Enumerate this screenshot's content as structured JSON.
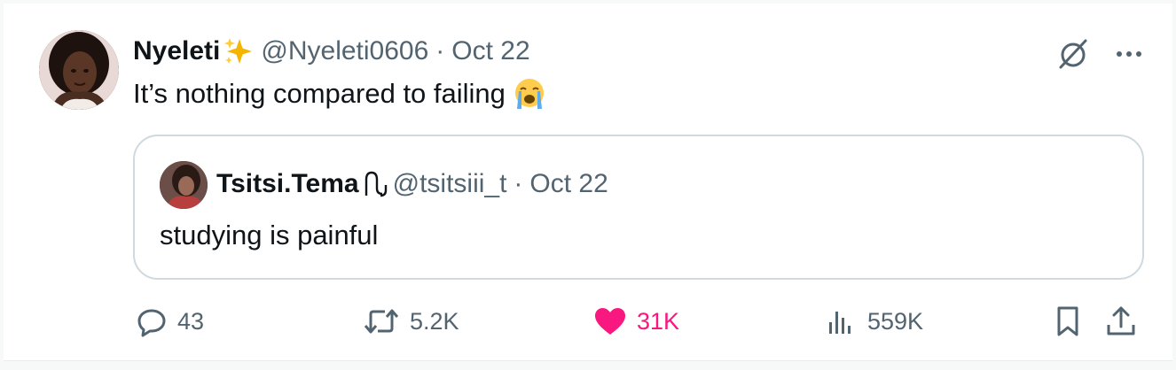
{
  "tweet": {
    "author_name": "Nyeleti",
    "author_handle": "@Nyeleti0606",
    "separator": "·",
    "date": "Oct 22",
    "text": "It’s nothing compared to failing"
  },
  "quoted_tweet": {
    "author_name": "Tsitsi.Tema",
    "author_handle": "@tsitsiii_t",
    "separator": "·",
    "date": "Oct 22",
    "text": "studying is painful"
  },
  "actions": {
    "replies": "43",
    "reposts": "5.2K",
    "likes": "31K",
    "views": "559K"
  },
  "icons": {
    "reply": "reply-icon",
    "repost": "repost-icon",
    "like": "heart-icon",
    "views": "views-chart-icon",
    "bookmark": "bookmark-icon",
    "share": "share-icon",
    "grok": "grok-icon",
    "more": "more-icon"
  },
  "colors": {
    "like_active": "#f91880",
    "secondary_text": "#536471",
    "primary_text": "#0f1419",
    "border": "#cfd9de"
  }
}
